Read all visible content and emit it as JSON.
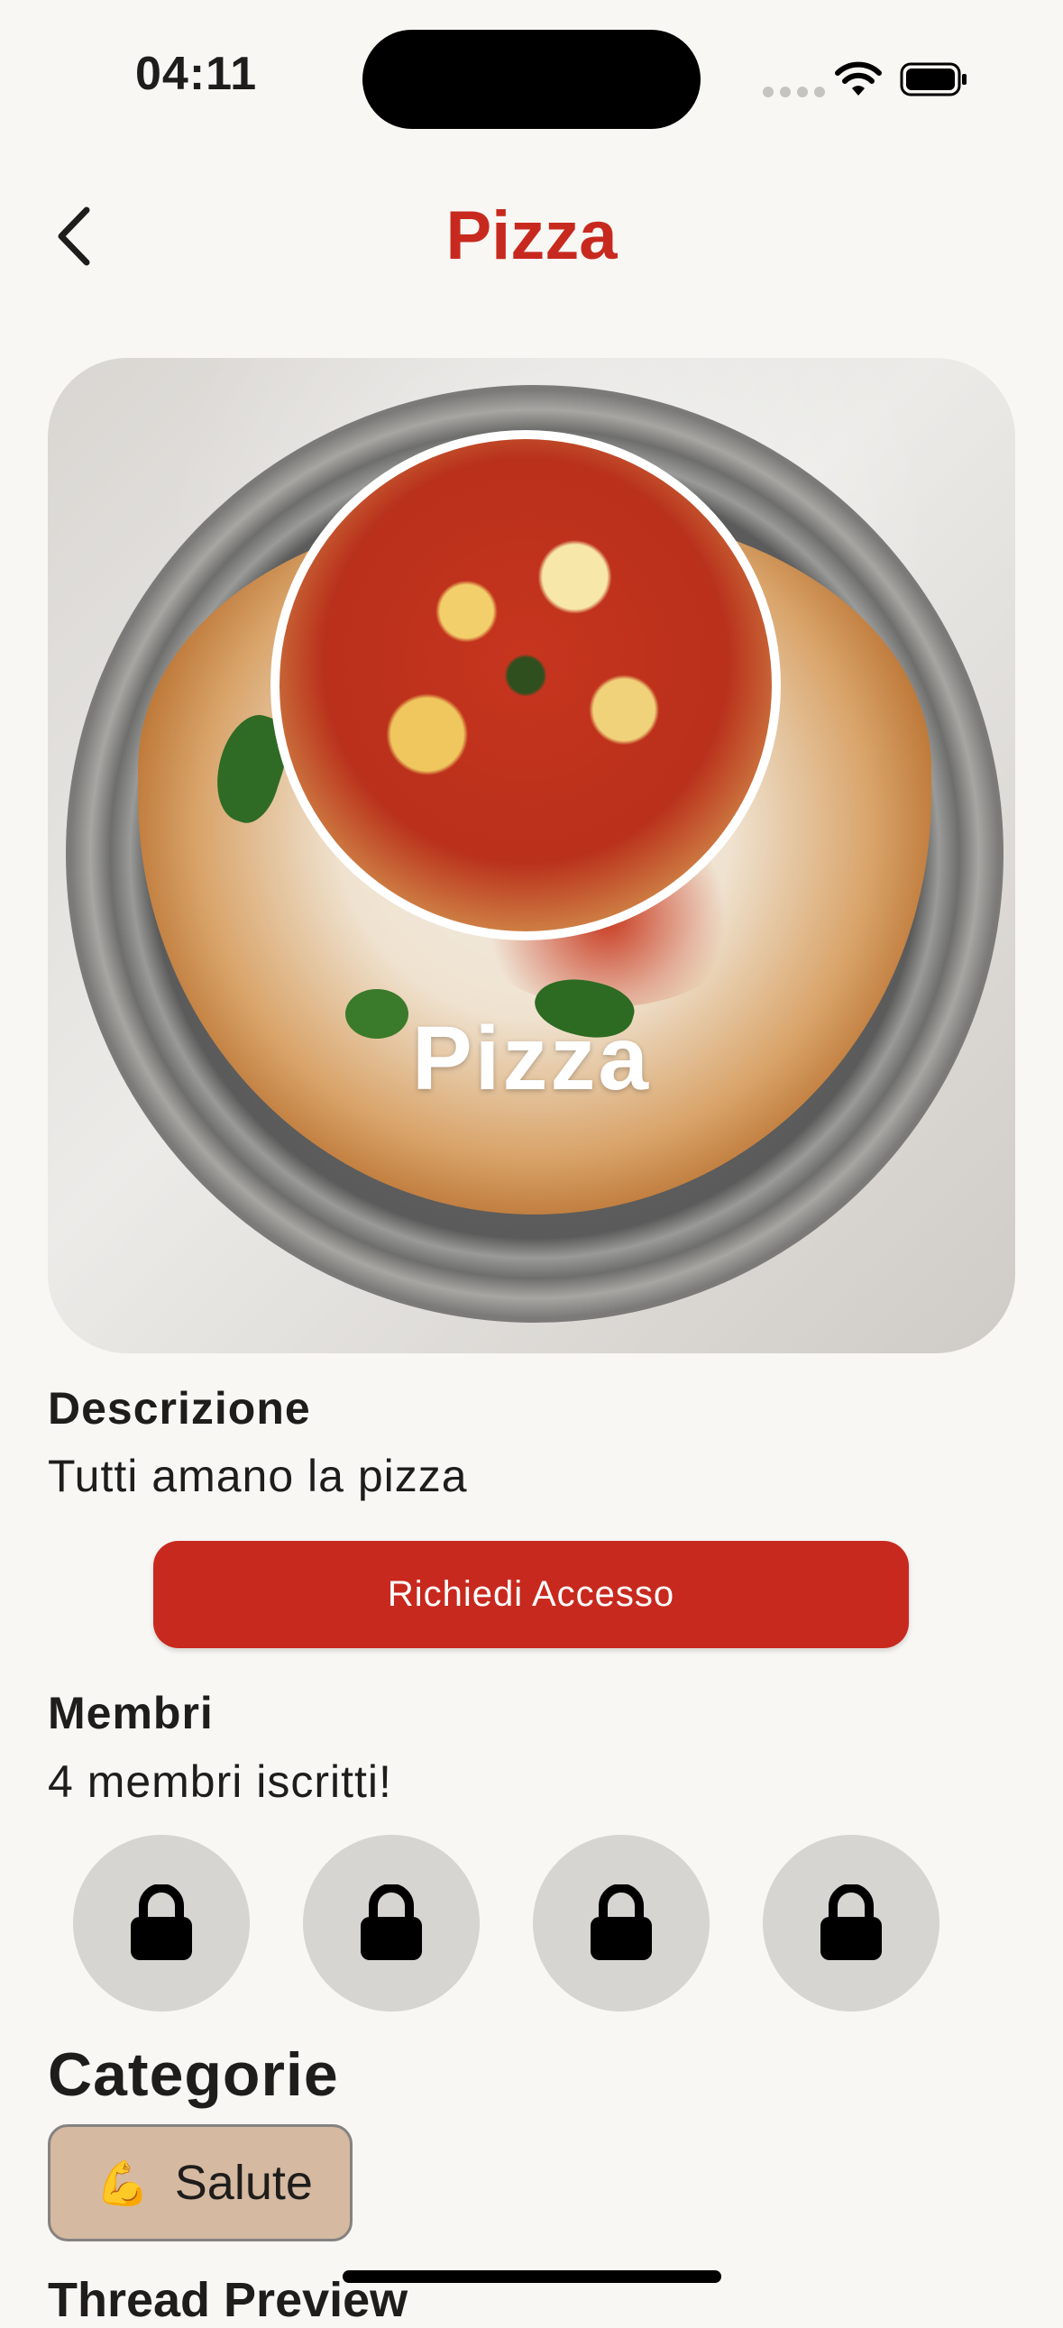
{
  "status_bar": {
    "time": "04:11"
  },
  "nav": {
    "title": "Pizza"
  },
  "hero": {
    "title": "Pizza"
  },
  "description": {
    "label": "Descrizione",
    "text": "Tutti amano la pizza"
  },
  "actions": {
    "request_access": "Richiedi Accesso"
  },
  "members": {
    "label": "Membri",
    "count_text": "4 membri iscritti!",
    "avatars": [
      {
        "icon": "lock-icon"
      },
      {
        "icon": "lock-icon"
      },
      {
        "icon": "lock-icon"
      },
      {
        "icon": "lock-icon"
      }
    ]
  },
  "categories": {
    "label": "Categorie",
    "items": [
      {
        "emoji": "💪",
        "label": "Salute"
      }
    ]
  },
  "thread_preview": {
    "label": "Thread Preview"
  },
  "colors": {
    "accent": "#c8291e",
    "background": "#f8f7f4",
    "chip": "#d5b9a1"
  }
}
